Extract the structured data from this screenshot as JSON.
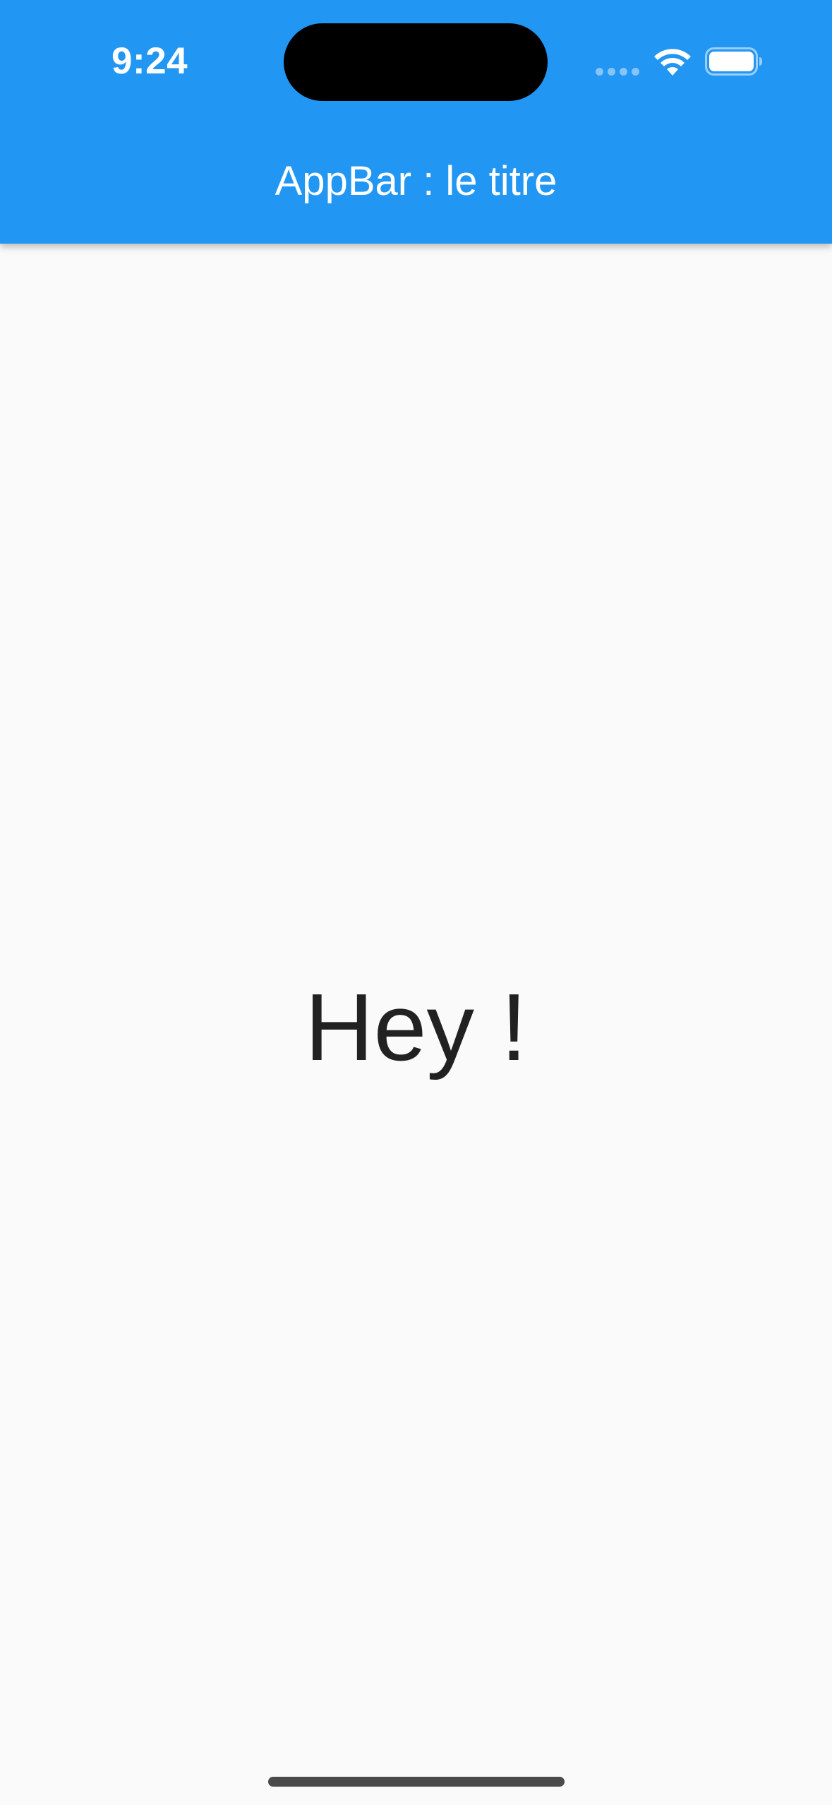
{
  "status_bar": {
    "time": "9:24",
    "icons": [
      "cellular-signal-icon",
      "wifi-icon",
      "battery-icon"
    ]
  },
  "app_bar": {
    "title": "AppBar : le titre",
    "background_color": "#2196F3",
    "title_color": "#FFFFFF"
  },
  "body": {
    "text": "Hey !",
    "text_color": "#212121",
    "background_color": "#FAFAFA"
  }
}
